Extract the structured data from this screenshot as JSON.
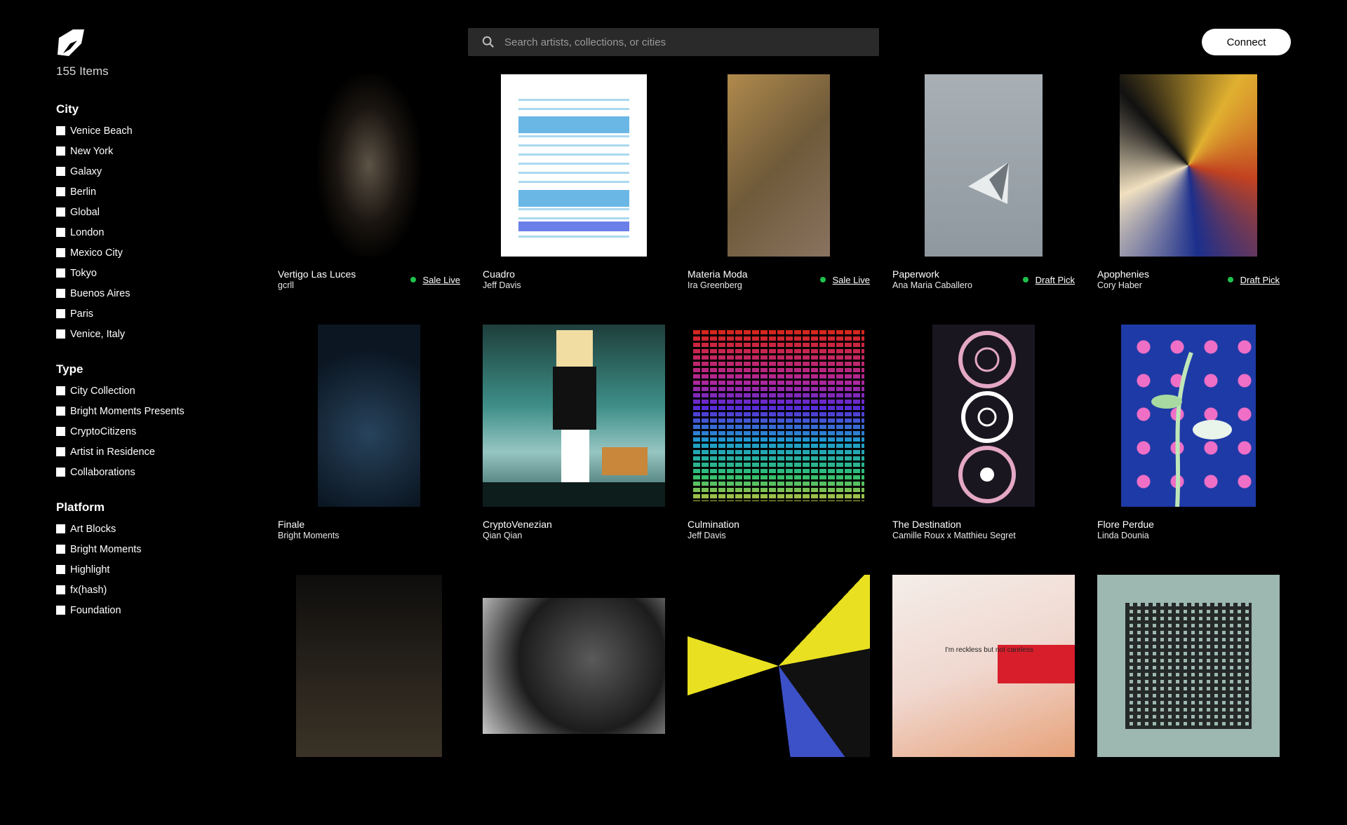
{
  "header": {
    "item_count": "155 Items",
    "search_placeholder": "Search artists, collections, or cities",
    "connect_label": "Connect"
  },
  "filters": {
    "city": {
      "title": "City",
      "options": [
        "Venice Beach",
        "New York",
        "Galaxy",
        "Berlin",
        "Global",
        "London",
        "Mexico City",
        "Tokyo",
        "Buenos Aires",
        "Paris",
        "Venice, Italy"
      ]
    },
    "type": {
      "title": "Type",
      "options": [
        "City Collection",
        "Bright Moments Presents",
        "CryptoCitizens",
        "Artist in Residence",
        "Collaborations"
      ]
    },
    "platform": {
      "title": "Platform",
      "options": [
        "Art Blocks",
        "Bright Moments",
        "Highlight",
        "fx(hash)",
        "Foundation"
      ]
    }
  },
  "status_color": "#1fc24b",
  "items": [
    {
      "title": "Vertigo Las Luces",
      "artist": "gcrll",
      "status": "Sale Live"
    },
    {
      "title": "Cuadro",
      "artist": "Jeff Davis",
      "status": ""
    },
    {
      "title": "Materia Moda",
      "artist": "Ira Greenberg",
      "status": "Sale Live"
    },
    {
      "title": "Paperwork",
      "artist": "Ana Maria Caballero",
      "status": "Draft Pick"
    },
    {
      "title": "Apophenies",
      "artist": "Cory Haber",
      "status": "Draft Pick"
    },
    {
      "title": "Finale",
      "artist": "Bright Moments",
      "status": ""
    },
    {
      "title": "CryptoVenezian",
      "artist": "Qian Qian",
      "status": ""
    },
    {
      "title": "Culmination",
      "artist": "Jeff Davis",
      "status": ""
    },
    {
      "title": "The Destination",
      "artist": "Camille Roux x Matthieu Segret",
      "status": ""
    },
    {
      "title": "Flore Perdue",
      "artist": "Linda Dounia",
      "status": ""
    },
    {
      "title": "",
      "artist": "",
      "status": ""
    },
    {
      "title": "",
      "artist": "",
      "status": ""
    },
    {
      "title": "",
      "artist": "",
      "status": ""
    },
    {
      "title": "",
      "artist": "",
      "status": ""
    },
    {
      "title": "",
      "artist": "",
      "status": ""
    }
  ],
  "artwork_texts": {
    "reckless": "I'm reckless but not careless"
  }
}
